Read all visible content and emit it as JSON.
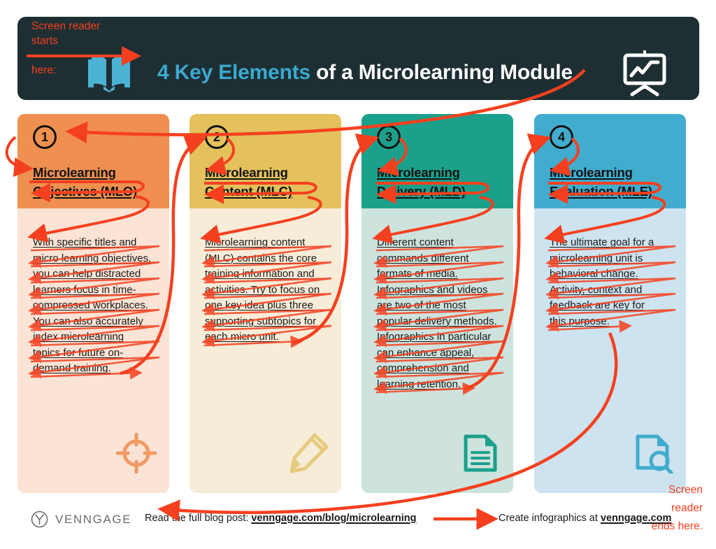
{
  "header": {
    "title_accent": "4 Key Elements",
    "title_rest": " of a Microlearning Module",
    "book_icon": "open-book-icon",
    "board_icon": "presentation-chart-icon",
    "bar_color": "#1d2f33",
    "accent_color": "#3ba8cf"
  },
  "annotations": {
    "start": "Screen reader\nstarts\n\nhere:",
    "start_line1": "Screen reader",
    "start_line2": "starts",
    "start_line3": "here:",
    "end": "Screen reader ends here.",
    "end_line1": "Screen",
    "end_line2": "reader",
    "end_line3": "ends here.",
    "color": "#f5401f"
  },
  "columns": [
    {
      "number": "1",
      "title_line1": "Microlearning",
      "title_line2": "Objectives (MLO)",
      "body_lines": [
        "With specific titles and",
        "micro learning objectives,",
        "you can help distracted",
        "learners focus in time-",
        "compressed workplaces.",
        "You can also accurately",
        "index microlearning",
        "topics for future on-",
        "demand training."
      ],
      "icon": "target-icon",
      "head_color": "#ef9050",
      "body_color": "#fbe3d5",
      "icon_color": "#f09a63"
    },
    {
      "number": "2",
      "title_line1": "Microlearning",
      "title_line2": "Content (MLC)",
      "body_lines": [
        "Microlearning content",
        "(MLC) contains the core",
        "training information and",
        "activities. Try to focus on",
        "one key idea plus three",
        "supporting subtopics for",
        "each micro unit."
      ],
      "icon": "pencil-icon",
      "head_color": "#e4c15c",
      "body_color": "#f7ecd8",
      "icon_color": "#e6cb7d"
    },
    {
      "number": "3",
      "title_line1": "Microlearning",
      "title_line2": "Delivery (MLD)",
      "body_lines": [
        "Different content",
        "commands different",
        "formats of media.",
        "Infographics and videos",
        "are two of the most",
        "popular delivery methods.",
        "Infographics in particular",
        "can enhance appeal,",
        "comprehension and",
        "learning retention."
      ],
      "icon": "document-icon",
      "head_color": "#1ba08b",
      "body_color": "#cee3dd",
      "icon_color": "#1ba08b"
    },
    {
      "number": "4",
      "title_line1": "Microlearning",
      "title_line2": "Evaluation (MLE)",
      "body_lines": [
        "The ultimate goal for a",
        "microlearning unit is",
        "behavioral change.",
        "Activity, context and",
        "feedback are key for",
        "this purpose."
      ],
      "icon": "document-search-icon",
      "head_color": "#41accd",
      "body_color": "#cde3ef",
      "icon_color": "#41accd"
    }
  ],
  "footer": {
    "brand": "VENNGAGE",
    "brand_icon": "venngage-circle-icon",
    "left_prefix": "Read the full blog post: ",
    "left_link": "venngage.com/blog/microlearning",
    "right_prefix": "Create infographics at ",
    "right_link": "venngage.com"
  }
}
